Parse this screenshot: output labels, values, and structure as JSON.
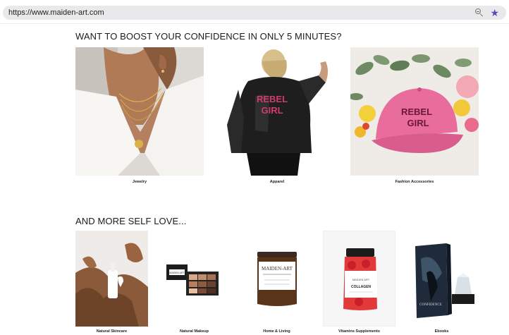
{
  "browser": {
    "url": "https://www.maiden-art.com",
    "zoom_icon": "zoom-out-icon",
    "bookmark_icon": "star-icon",
    "accent_color": "#5b4bb3"
  },
  "sections": {
    "top": {
      "heading": "WANT TO BOOST YOUR CONFIDENCE IN ONLY 5 MINUTES?",
      "items": [
        {
          "label": "Jewelry"
        },
        {
          "label": "Apparel"
        },
        {
          "label": "Fashion Accessories"
        }
      ]
    },
    "bottom": {
      "heading": "AND MORE SELF LOVE...",
      "items": [
        {
          "label": "Natural Skincare"
        },
        {
          "label": "Natural Makeup"
        },
        {
          "label": "Home & Living"
        },
        {
          "label": "Vitamins Supplements"
        },
        {
          "label": "Ebooks"
        }
      ]
    }
  },
  "product_text": {
    "jacket_print": "REBEL GIRL",
    "cap_print": "REBEL GIRL",
    "candle_brand": "MAIDEN-ART",
    "vitamin_brand": "COLLAGEN",
    "palette_brand": "MAIDEN ART"
  }
}
